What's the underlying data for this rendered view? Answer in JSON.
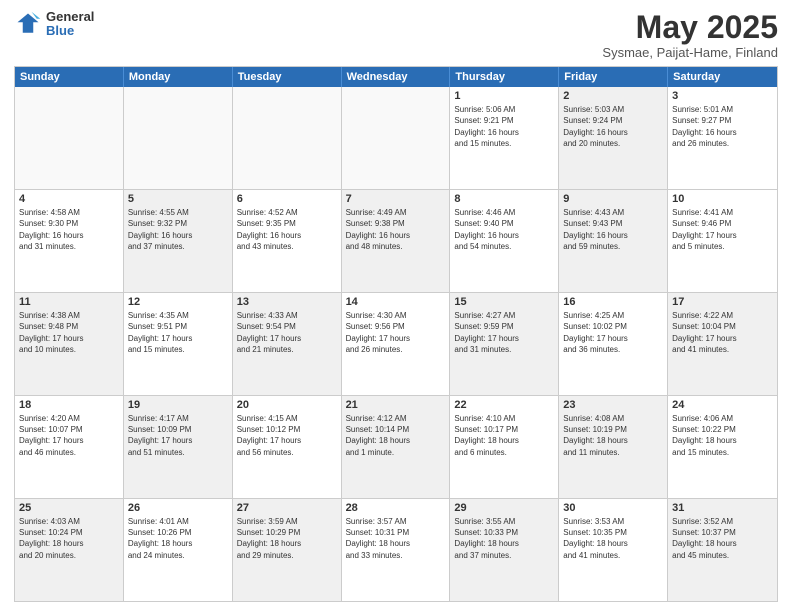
{
  "logo": {
    "general": "General",
    "blue": "Blue"
  },
  "title": "May 2025",
  "subtitle": "Sysmae, Paijat-Hame, Finland",
  "header_days": [
    "Sunday",
    "Monday",
    "Tuesday",
    "Wednesday",
    "Thursday",
    "Friday",
    "Saturday"
  ],
  "rows": [
    [
      {
        "day": "",
        "info": "",
        "empty": true
      },
      {
        "day": "",
        "info": "",
        "empty": true
      },
      {
        "day": "",
        "info": "",
        "empty": true
      },
      {
        "day": "",
        "info": "",
        "empty": true
      },
      {
        "day": "1",
        "info": "Sunrise: 5:06 AM\nSunset: 9:21 PM\nDaylight: 16 hours\nand 15 minutes."
      },
      {
        "day": "2",
        "info": "Sunrise: 5:03 AM\nSunset: 9:24 PM\nDaylight: 16 hours\nand 20 minutes.",
        "shaded": true
      },
      {
        "day": "3",
        "info": "Sunrise: 5:01 AM\nSunset: 9:27 PM\nDaylight: 16 hours\nand 26 minutes."
      }
    ],
    [
      {
        "day": "4",
        "info": "Sunrise: 4:58 AM\nSunset: 9:30 PM\nDaylight: 16 hours\nand 31 minutes."
      },
      {
        "day": "5",
        "info": "Sunrise: 4:55 AM\nSunset: 9:32 PM\nDaylight: 16 hours\nand 37 minutes.",
        "shaded": true
      },
      {
        "day": "6",
        "info": "Sunrise: 4:52 AM\nSunset: 9:35 PM\nDaylight: 16 hours\nand 43 minutes."
      },
      {
        "day": "7",
        "info": "Sunrise: 4:49 AM\nSunset: 9:38 PM\nDaylight: 16 hours\nand 48 minutes.",
        "shaded": true
      },
      {
        "day": "8",
        "info": "Sunrise: 4:46 AM\nSunset: 9:40 PM\nDaylight: 16 hours\nand 54 minutes."
      },
      {
        "day": "9",
        "info": "Sunrise: 4:43 AM\nSunset: 9:43 PM\nDaylight: 16 hours\nand 59 minutes.",
        "shaded": true
      },
      {
        "day": "10",
        "info": "Sunrise: 4:41 AM\nSunset: 9:46 PM\nDaylight: 17 hours\nand 5 minutes."
      }
    ],
    [
      {
        "day": "11",
        "info": "Sunrise: 4:38 AM\nSunset: 9:48 PM\nDaylight: 17 hours\nand 10 minutes.",
        "shaded": true
      },
      {
        "day": "12",
        "info": "Sunrise: 4:35 AM\nSunset: 9:51 PM\nDaylight: 17 hours\nand 15 minutes."
      },
      {
        "day": "13",
        "info": "Sunrise: 4:33 AM\nSunset: 9:54 PM\nDaylight: 17 hours\nand 21 minutes.",
        "shaded": true
      },
      {
        "day": "14",
        "info": "Sunrise: 4:30 AM\nSunset: 9:56 PM\nDaylight: 17 hours\nand 26 minutes."
      },
      {
        "day": "15",
        "info": "Sunrise: 4:27 AM\nSunset: 9:59 PM\nDaylight: 17 hours\nand 31 minutes.",
        "shaded": true
      },
      {
        "day": "16",
        "info": "Sunrise: 4:25 AM\nSunset: 10:02 PM\nDaylight: 17 hours\nand 36 minutes."
      },
      {
        "day": "17",
        "info": "Sunrise: 4:22 AM\nSunset: 10:04 PM\nDaylight: 17 hours\nand 41 minutes.",
        "shaded": true
      }
    ],
    [
      {
        "day": "18",
        "info": "Sunrise: 4:20 AM\nSunset: 10:07 PM\nDaylight: 17 hours\nand 46 minutes."
      },
      {
        "day": "19",
        "info": "Sunrise: 4:17 AM\nSunset: 10:09 PM\nDaylight: 17 hours\nand 51 minutes.",
        "shaded": true
      },
      {
        "day": "20",
        "info": "Sunrise: 4:15 AM\nSunset: 10:12 PM\nDaylight: 17 hours\nand 56 minutes."
      },
      {
        "day": "21",
        "info": "Sunrise: 4:12 AM\nSunset: 10:14 PM\nDaylight: 18 hours\nand 1 minute.",
        "shaded": true
      },
      {
        "day": "22",
        "info": "Sunrise: 4:10 AM\nSunset: 10:17 PM\nDaylight: 18 hours\nand 6 minutes."
      },
      {
        "day": "23",
        "info": "Sunrise: 4:08 AM\nSunset: 10:19 PM\nDaylight: 18 hours\nand 11 minutes.",
        "shaded": true
      },
      {
        "day": "24",
        "info": "Sunrise: 4:06 AM\nSunset: 10:22 PM\nDaylight: 18 hours\nand 15 minutes."
      }
    ],
    [
      {
        "day": "25",
        "info": "Sunrise: 4:03 AM\nSunset: 10:24 PM\nDaylight: 18 hours\nand 20 minutes.",
        "shaded": true
      },
      {
        "day": "26",
        "info": "Sunrise: 4:01 AM\nSunset: 10:26 PM\nDaylight: 18 hours\nand 24 minutes."
      },
      {
        "day": "27",
        "info": "Sunrise: 3:59 AM\nSunset: 10:29 PM\nDaylight: 18 hours\nand 29 minutes.",
        "shaded": true
      },
      {
        "day": "28",
        "info": "Sunrise: 3:57 AM\nSunset: 10:31 PM\nDaylight: 18 hours\nand 33 minutes."
      },
      {
        "day": "29",
        "info": "Sunrise: 3:55 AM\nSunset: 10:33 PM\nDaylight: 18 hours\nand 37 minutes.",
        "shaded": true
      },
      {
        "day": "30",
        "info": "Sunrise: 3:53 AM\nSunset: 10:35 PM\nDaylight: 18 hours\nand 41 minutes."
      },
      {
        "day": "31",
        "info": "Sunrise: 3:52 AM\nSunset: 10:37 PM\nDaylight: 18 hours\nand 45 minutes.",
        "shaded": true
      }
    ]
  ]
}
